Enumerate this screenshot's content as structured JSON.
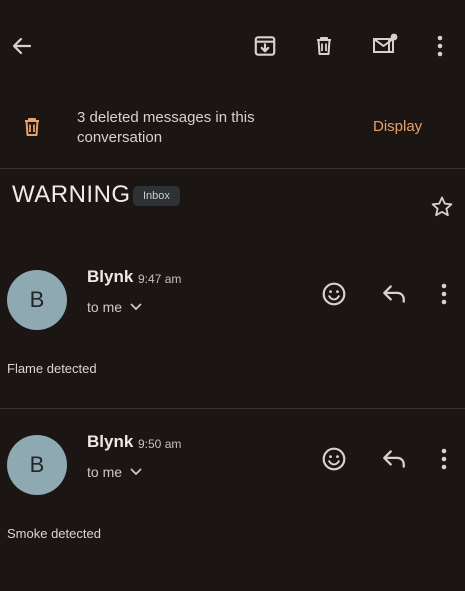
{
  "toolbar": {
    "back_icon": "arrow-back-icon",
    "archive_icon": "archive-icon",
    "delete_icon": "trash-icon",
    "unread_icon": "mark-unread-icon",
    "more_icon": "more-vert-icon"
  },
  "deleted_banner": {
    "text": "3 deleted messages in this conversation",
    "action_label": "Display",
    "icon": "trash-icon"
  },
  "thread": {
    "subject": "WARNING",
    "label": "Inbox",
    "star_icon": "star-outline-icon"
  },
  "messages": [
    {
      "avatar_letter": "B",
      "sender": "Blynk",
      "time": "9:47 am",
      "recipient": "to me",
      "body": "Flame detected"
    },
    {
      "avatar_letter": "B",
      "sender": "Blynk",
      "time": "9:50 am",
      "recipient": "to me",
      "body": "Smoke detected"
    }
  ],
  "colors": {
    "background": "#1b1613",
    "accent": "#e9a06a",
    "avatar": "#8fa9b3"
  }
}
